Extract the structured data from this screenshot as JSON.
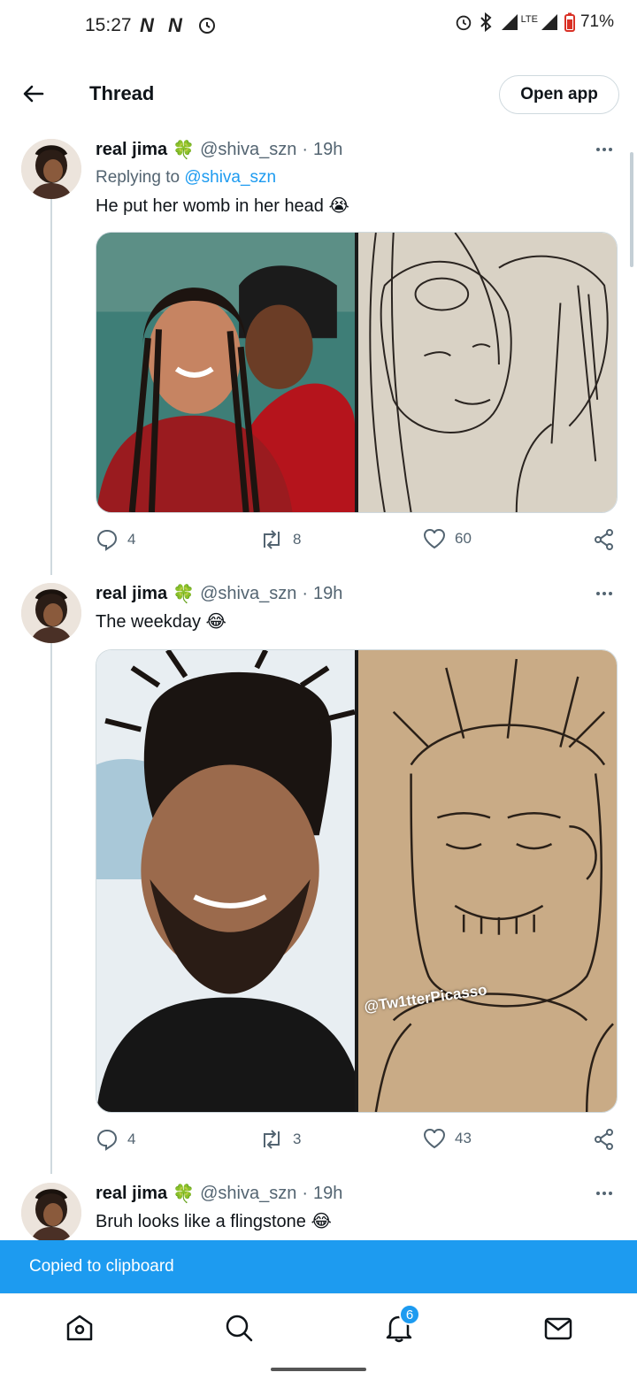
{
  "status_bar": {
    "time": "15:27",
    "lte": "LTE",
    "battery": "71%"
  },
  "header": {
    "title": "Thread",
    "open_app": "Open app"
  },
  "tweets": [
    {
      "name": "real jima",
      "name_emoji": "🍀",
      "handle": "@shiva_szn",
      "sep": "·",
      "time": "19h",
      "replying_prefix": "Replying to ",
      "replying_handle": "@shiva_szn",
      "text": "He put her womb in her head",
      "emoji": "😭",
      "replies": "4",
      "retweets": "8",
      "likes": "60"
    },
    {
      "name": "real jima",
      "name_emoji": "🍀",
      "handle": "@shiva_szn",
      "sep": "·",
      "time": "19h",
      "text": "The weekday",
      "emoji": "😂",
      "watermark": "@Tw1tterPicasso",
      "replies": "4",
      "retweets": "3",
      "likes": "43"
    },
    {
      "name": "real jima",
      "name_emoji": "🍀",
      "handle": "@shiva_szn",
      "sep": "·",
      "time": "19h",
      "text": "Bruh looks like a flingstone",
      "emoji": "😂"
    }
  ],
  "toast": "Copied to clipboard",
  "bottom_nav": {
    "notifications_badge": "6"
  },
  "colors": {
    "accent": "#1d9bf0",
    "secondary_text": "#536471",
    "border": "#cfd9de"
  }
}
